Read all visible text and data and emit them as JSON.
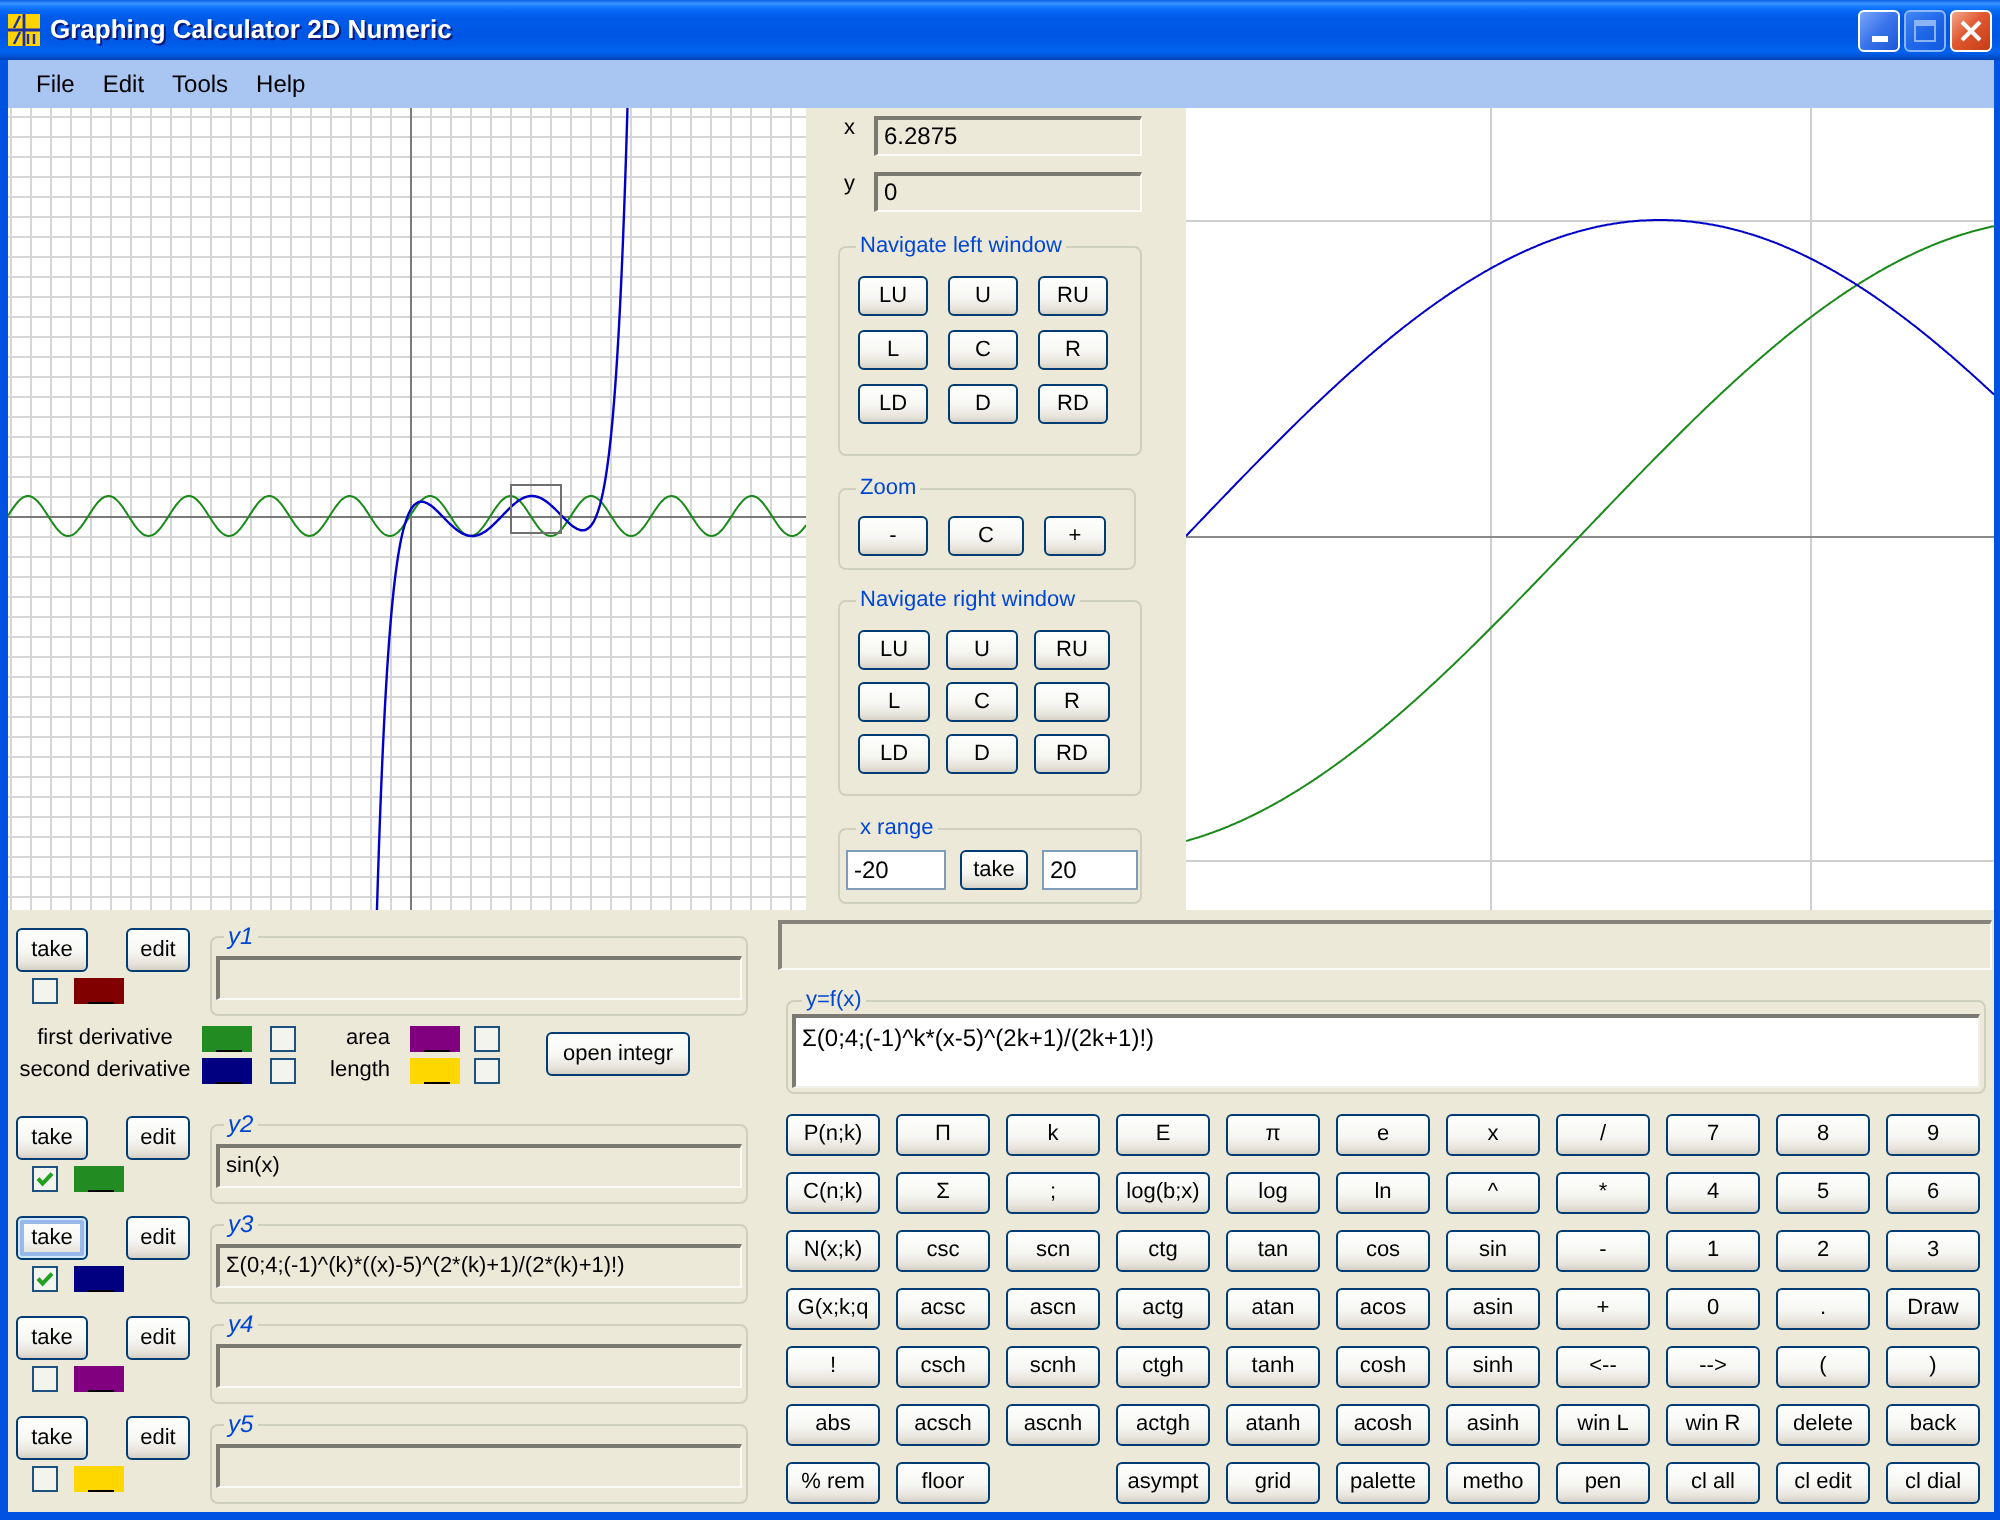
{
  "window": {
    "title": "Graphing Calculator 2D Numeric",
    "maximize_disabled": true
  },
  "menu": [
    "File",
    "Edit",
    "Tools",
    "Help"
  ],
  "coordinates": [
    {
      "label": "x",
      "value": "6.2875"
    },
    {
      "label": "y",
      "value": "0"
    }
  ],
  "navigate_left_window": {
    "title": "Navigate left window",
    "buttons": [
      "LU",
      "U",
      "RU",
      "L",
      "C",
      "R",
      "LD",
      "D",
      "RD"
    ]
  },
  "zoom": {
    "title": "Zoom",
    "buttons": [
      "-",
      "C",
      "+"
    ]
  },
  "navigate_right_window": {
    "title": "Navigate right window",
    "buttons": [
      "LU",
      "U",
      "RU",
      "L",
      "C",
      "R",
      "LD",
      "D",
      "RD"
    ]
  },
  "x_range": {
    "title": "x range",
    "from": "-20",
    "button": "take",
    "to": "20"
  },
  "functions": [
    {
      "label": "y1",
      "take_button": "take",
      "edit_button": "edit",
      "take_focused": false,
      "checked": false,
      "color": "#800000"
    },
    {
      "label": "y2",
      "take_button": "take",
      "edit_button": "edit",
      "take_focused": false,
      "checked": true,
      "color": "#228b22",
      "value": "sin(x)"
    },
    {
      "label": "y3",
      "take_button": "take",
      "edit_button": "edit",
      "take_focused": true,
      "checked": true,
      "color": "#000080",
      "value": "Σ(0;4;(-1)^(k)*((x)-5)^(2*(k)+1)/(2*(k)+1)!)"
    },
    {
      "label": "y4",
      "take_button": "take",
      "edit_button": "edit",
      "take_focused": false,
      "checked": false,
      "color": "#800080"
    },
    {
      "label": "y5",
      "take_button": "take",
      "edit_button": "edit",
      "take_focused": false,
      "checked": false,
      "color": "#ffd700"
    }
  ],
  "derivatives": [
    {
      "label": "first derivative",
      "color": "#228b22",
      "checked": false
    },
    {
      "label": "second derivative",
      "color": "#000080",
      "checked": false
    }
  ],
  "integrals": [
    {
      "label": "area",
      "color": "#800080",
      "checked": false
    },
    {
      "label": "length",
      "color": "#ffd700",
      "checked": false
    }
  ],
  "open_integral_button": "open integr",
  "expression": {
    "title": "y=f(x)",
    "value": "Σ(0;4;(-1)^k*(x-5)^(2k+1)/(2k+1)!)"
  },
  "keypad": [
    [
      "P(n;k)",
      "Π",
      "k",
      "E",
      "π",
      "e",
      "x",
      "/",
      "7",
      "8",
      "9"
    ],
    [
      "C(n;k)",
      "Σ",
      ";",
      "log(b;x)",
      "log",
      "ln",
      "^",
      "*",
      "4",
      "5",
      "6"
    ],
    [
      "N(x;k)",
      "csc",
      "scn",
      "ctg",
      "tan",
      "cos",
      "sin",
      "-",
      "1",
      "2",
      "3"
    ],
    [
      "G(x;k;q",
      "acsc",
      "ascn",
      "actg",
      "atan",
      "acos",
      "asin",
      "+",
      "0",
      ".",
      "Draw"
    ],
    [
      "!",
      "csch",
      "scnh",
      "ctgh",
      "tanh",
      "cosh",
      "sinh",
      "<--",
      "-->",
      "(",
      ")"
    ],
    [
      "abs",
      "acsch",
      "ascnh",
      "actgh",
      "atanh",
      "acosh",
      "asinh",
      "win L",
      "win R",
      "delete",
      "back"
    ],
    [
      "% rem",
      "floor",
      "asympt",
      "grid",
      "palette",
      "metho",
      "pen",
      "cl all",
      "cl edit",
      "cl dial"
    ]
  ]
}
